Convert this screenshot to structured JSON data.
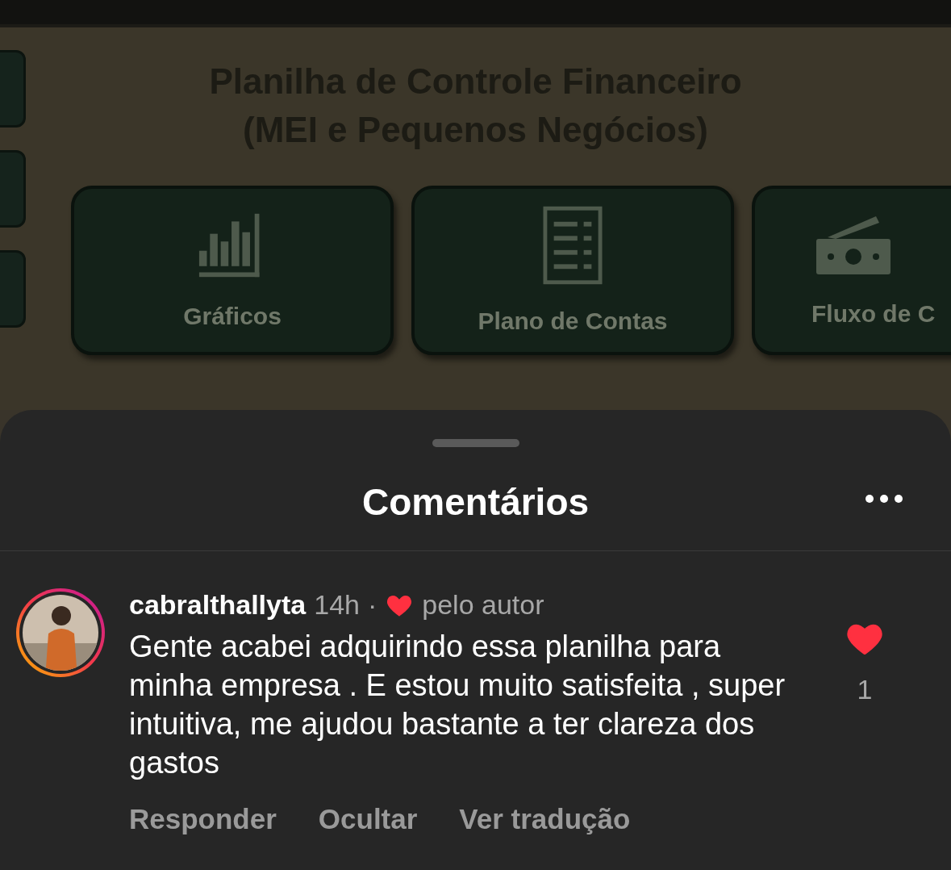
{
  "background": {
    "title_lines": [
      "Planilha de Controle Financeiro",
      "(MEI e Pequenos Negócios)"
    ],
    "tiles": [
      {
        "label": "Gráficos",
        "kind": "chart"
      },
      {
        "label": "Plano de Contas",
        "kind": "list"
      },
      {
        "label": "Fluxo de C",
        "kind": "money"
      }
    ]
  },
  "sheet": {
    "title": "Comentários"
  },
  "comments": [
    {
      "username": "cabralthallyta",
      "time": "14h",
      "separator": "·",
      "liked_by_author": true,
      "author_label": "pelo autor",
      "text": "Gente acabei adquirindo essa planilha para minha empresa . E estou muito satisfeita , super intuitiva, me ajudou bastante a ter clareza dos gastos",
      "liked": true,
      "like_count": "1",
      "actions": [
        "Responder",
        "Ocultar",
        "Ver tradução"
      ]
    }
  ]
}
